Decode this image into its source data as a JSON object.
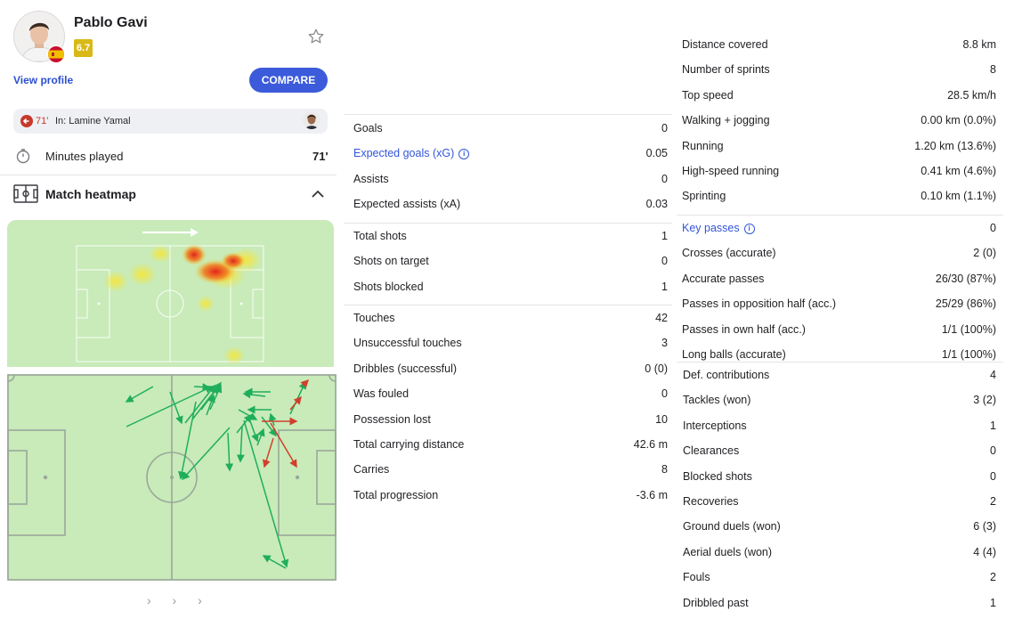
{
  "player": {
    "name": "Pablo Gavi",
    "rating": "6.7",
    "view_profile": "View profile",
    "compare": "COMPARE"
  },
  "substitution": {
    "minute": "71'",
    "text": "In: Lamine Yamal"
  },
  "minutes": {
    "label": "Minutes played",
    "value": "71'"
  },
  "heatmap": {
    "title": "Match heatmap"
  },
  "pager": "› › ›",
  "stats_col1": {
    "group1": [
      {
        "label": "Goals",
        "value": "0"
      },
      {
        "label": "Expected goals (xG)",
        "value": "0.05",
        "link": true,
        "info": true
      },
      {
        "label": "Assists",
        "value": "0"
      },
      {
        "label": "Expected assists (xA)",
        "value": "0.03"
      }
    ],
    "group2": [
      {
        "label": "Total shots",
        "value": "1"
      },
      {
        "label": "Shots on target",
        "value": "0"
      },
      {
        "label": "Shots blocked",
        "value": "1"
      }
    ],
    "group3": [
      {
        "label": "Touches",
        "value": "42"
      },
      {
        "label": "Unsuccessful touches",
        "value": "3"
      },
      {
        "label": "Dribbles (successful)",
        "value": "0 (0)"
      },
      {
        "label": "Was fouled",
        "value": "0"
      },
      {
        "label": "Possession lost",
        "value": "10"
      },
      {
        "label": "Total carrying distance",
        "value": "42.6 m"
      },
      {
        "label": "Carries",
        "value": "8"
      },
      {
        "label": "Total progression",
        "value": "-3.6 m"
      }
    ]
  },
  "stats_col2": {
    "group1": [
      {
        "label": "Distance covered",
        "value": "8.8 km"
      },
      {
        "label": "Number of sprints",
        "value": "8"
      },
      {
        "label": "Top speed",
        "value": "28.5 km/h"
      },
      {
        "label": "Walking + jogging",
        "value": "0.00 km (0.0%)"
      },
      {
        "label": "Running",
        "value": "1.20 km (13.6%)"
      },
      {
        "label": "High-speed running",
        "value": "0.41 km (4.6%)"
      },
      {
        "label": "Sprinting",
        "value": "0.10 km (1.1%)"
      }
    ],
    "group2": [
      {
        "label": "Key passes",
        "value": "0",
        "link": true,
        "info": true
      },
      {
        "label": "Crosses (accurate)",
        "value": "2 (0)"
      },
      {
        "label": "Accurate passes",
        "value": "26/30 (87%)"
      },
      {
        "label": "Passes in opposition half (acc.)",
        "value": "25/29 (86%)"
      },
      {
        "label": "Passes in own half (acc.)",
        "value": "1/1 (100%)"
      },
      {
        "label": "Long balls (accurate)",
        "value": "1/1 (100%)"
      }
    ],
    "group3": [
      {
        "label": "Def. contributions",
        "value": "4"
      },
      {
        "label": "Tackles (won)",
        "value": "3 (2)"
      },
      {
        "label": "Interceptions",
        "value": "1"
      },
      {
        "label": "Clearances",
        "value": "0"
      },
      {
        "label": "Blocked shots",
        "value": "0"
      },
      {
        "label": "Recoveries",
        "value": "2"
      },
      {
        "label": "Ground duels (won)",
        "value": "6 (3)"
      },
      {
        "label": "Aerial duels (won)",
        "value": "4 (4)"
      },
      {
        "label": "Fouls",
        "value": "2"
      },
      {
        "label": "Dribbled past",
        "value": "1"
      }
    ]
  },
  "colors": {
    "pitch": "#c8ebb9",
    "accent": "#3b5bdb",
    "pass_success": "#1fae5b",
    "pass_fail": "#d0402c",
    "rating": "#d9b917"
  }
}
